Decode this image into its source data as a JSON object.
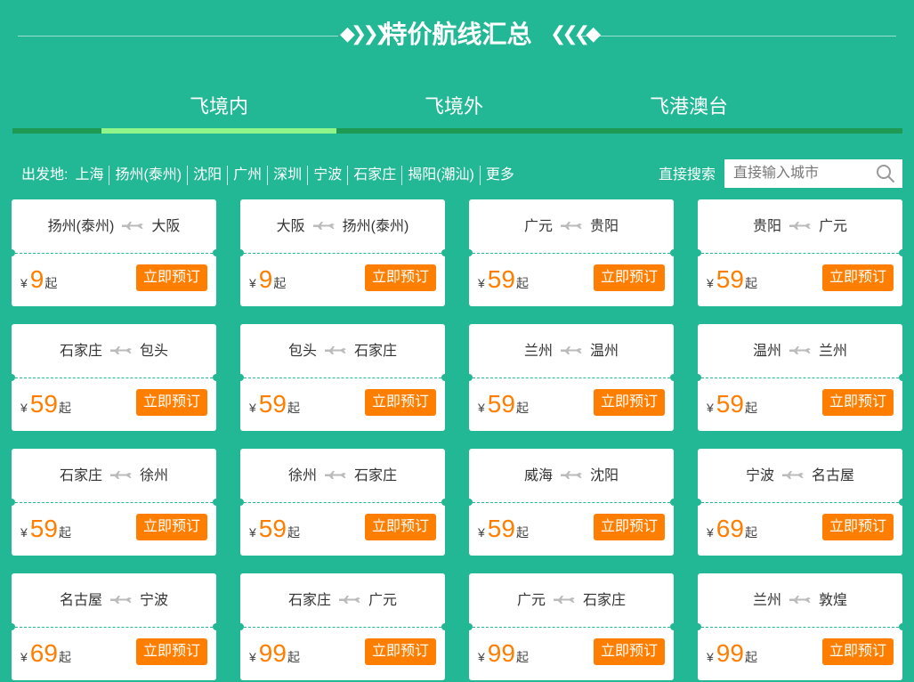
{
  "title": "特价航线汇总",
  "tabs": [
    {
      "label": "飞境内",
      "active": true
    },
    {
      "label": "飞境外",
      "active": false
    },
    {
      "label": "飞港澳台",
      "active": false
    }
  ],
  "filter": {
    "label": "出发地:",
    "cities": [
      "上海",
      "扬州(泰州)",
      "沈阳",
      "广州",
      "深圳",
      "宁波",
      "石家庄",
      "揭阳(潮汕)",
      "更多"
    ]
  },
  "search": {
    "label": "直接搜索",
    "placeholder": "直接输入城市"
  },
  "colors": {
    "background": "#22b795",
    "accent": "#ff7e00",
    "tab_active_line": "#8ff58a"
  },
  "card_labels": {
    "currency": "¥",
    "suffix": "起",
    "book_label": "立即预订"
  },
  "routes": [
    {
      "from": "扬州(泰州)",
      "to": "大阪",
      "price": "9"
    },
    {
      "from": "大阪",
      "to": "扬州(泰州)",
      "price": "9"
    },
    {
      "from": "广元",
      "to": "贵阳",
      "price": "59"
    },
    {
      "from": "贵阳",
      "to": "广元",
      "price": "59"
    },
    {
      "from": "石家庄",
      "to": "包头",
      "price": "59"
    },
    {
      "from": "包头",
      "to": "石家庄",
      "price": "59"
    },
    {
      "from": "兰州",
      "to": "温州",
      "price": "59"
    },
    {
      "from": "温州",
      "to": "兰州",
      "price": "59"
    },
    {
      "from": "石家庄",
      "to": "徐州",
      "price": "59"
    },
    {
      "from": "徐州",
      "to": "石家庄",
      "price": "59"
    },
    {
      "from": "威海",
      "to": "沈阳",
      "price": "59"
    },
    {
      "from": "宁波",
      "to": "名古屋",
      "price": "69"
    },
    {
      "from": "名古屋",
      "to": "宁波",
      "price": "69"
    },
    {
      "from": "石家庄",
      "to": "广元",
      "price": "99"
    },
    {
      "from": "广元",
      "to": "石家庄",
      "price": "99"
    },
    {
      "from": "兰州",
      "to": "敦煌",
      "price": "99"
    }
  ]
}
